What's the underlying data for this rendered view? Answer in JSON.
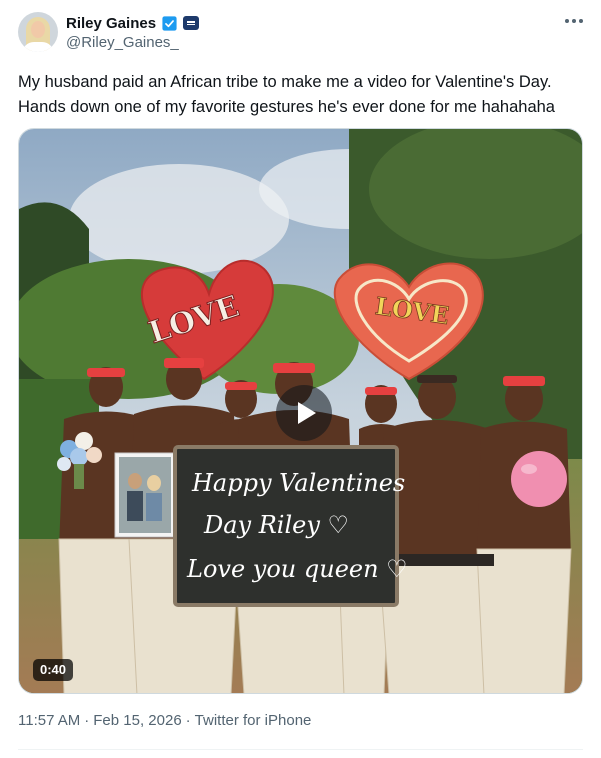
{
  "author": {
    "display_name": "Riley Gaines",
    "handle": "@Riley_Gaines_"
  },
  "tweet": {
    "text": "My husband paid an African tribe to make me a video for Valentine's Day.\nHands down one of my favorite gestures he's ever done for me hahahaha"
  },
  "media": {
    "duration": "0:40",
    "signs": {
      "left_heart": "LOVE",
      "right_heart": "LOVE"
    },
    "chalkboard_lines": [
      "Happy Valentines",
      "Day Riley ♡",
      "Love you queen ♡"
    ]
  },
  "meta": {
    "time": "11:57 AM",
    "separator": "·",
    "date": "Feb 15, 2026",
    "source": "Twitter for iPhone"
  },
  "colors": {
    "verified_blue": "#1d9bf0",
    "text_secondary": "#536471",
    "heart_red": "#d63b3a",
    "heart_salmon": "#e8674f"
  }
}
